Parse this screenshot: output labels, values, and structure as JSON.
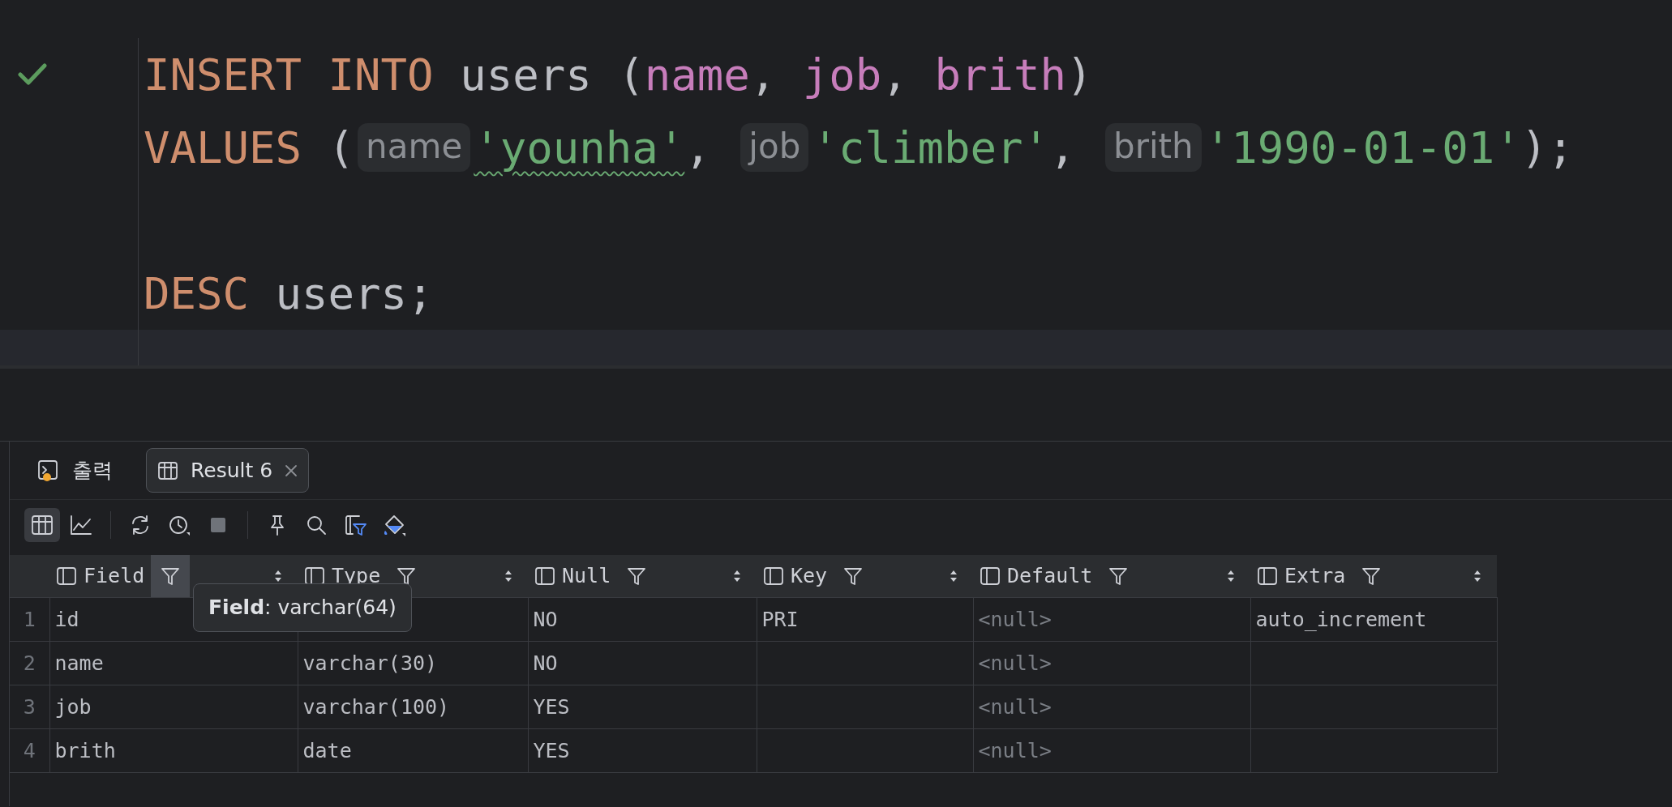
{
  "editor": {
    "lines": [
      {
        "current": false,
        "passed": true,
        "tokens": [
          {
            "kind": "keyword",
            "text": "INSERT INTO"
          },
          {
            "kind": "plain",
            "text": " users ("
          },
          {
            "kind": "column",
            "text": "name"
          },
          {
            "kind": "plain",
            "text": ", "
          },
          {
            "kind": "column",
            "text": "job"
          },
          {
            "kind": "plain",
            "text": ", "
          },
          {
            "kind": "column",
            "text": "brith"
          },
          {
            "kind": "plain",
            "text": ")"
          }
        ]
      },
      {
        "current": false,
        "tokens": [
          {
            "kind": "keyword",
            "text": "VALUES"
          },
          {
            "kind": "plain",
            "text": " ("
          },
          {
            "kind": "hint",
            "text": "name"
          },
          {
            "kind": "string",
            "text": "'younha'",
            "squiggle": true
          },
          {
            "kind": "plain",
            "text": ", "
          },
          {
            "kind": "hint",
            "text": "job"
          },
          {
            "kind": "string",
            "text": "'climber'"
          },
          {
            "kind": "plain",
            "text": ", "
          },
          {
            "kind": "hint",
            "text": "brith"
          },
          {
            "kind": "string",
            "text": "'1990-01-01'"
          },
          {
            "kind": "plain",
            "text": ");"
          }
        ]
      },
      {
        "current": false
      },
      {
        "current": false,
        "tokens": [
          {
            "kind": "keyword",
            "text": "DESC"
          },
          {
            "kind": "plain",
            "text": " users;"
          }
        ]
      },
      {
        "current": true
      }
    ]
  },
  "tabs": [
    {
      "label": "출력",
      "kind": "output",
      "selected": false
    },
    {
      "label": "Result 6",
      "kind": "result",
      "selected": true,
      "closable": true
    }
  ],
  "toolbar": [
    [
      {
        "kind": "table",
        "selected": true
      },
      {
        "kind": "chart",
        "selected": false
      }
    ],
    [
      {
        "kind": "refresh",
        "selected": false
      },
      {
        "kind": "history",
        "selected": false
      },
      {
        "kind": "stop",
        "selected": false
      }
    ],
    [
      {
        "kind": "pin",
        "selected": false
      },
      {
        "kind": "search",
        "selected": false
      },
      {
        "kind": "filter",
        "selected": false
      },
      {
        "kind": "paint",
        "selected": false
      }
    ]
  ],
  "table": {
    "columns": [
      {
        "label": "Field",
        "filter_hovered": true
      },
      {
        "label": "Type",
        "filter_hovered": false
      },
      {
        "label": "Null",
        "filter_hovered": false
      },
      {
        "label": "Key",
        "filter_hovered": false
      },
      {
        "label": "Default",
        "filter_hovered": false
      },
      {
        "label": "Extra",
        "filter_hovered": false
      }
    ],
    "rows": [
      {
        "number": "1",
        "cells": [
          "id",
          null,
          "NO",
          "PRI",
          "<null>",
          "auto_increment"
        ]
      },
      {
        "number": "2",
        "cells": [
          "name",
          "varchar(30)",
          "NO",
          null,
          "<null>",
          null
        ]
      },
      {
        "number": "3",
        "cells": [
          "job",
          "varchar(100)",
          "YES",
          null,
          "<null>",
          null
        ]
      },
      {
        "number": "4",
        "cells": [
          "brith",
          "date",
          "YES",
          null,
          "<null>",
          null
        ]
      }
    ]
  },
  "tooltip": {
    "text": "**Field**: varchar(64)"
  }
}
